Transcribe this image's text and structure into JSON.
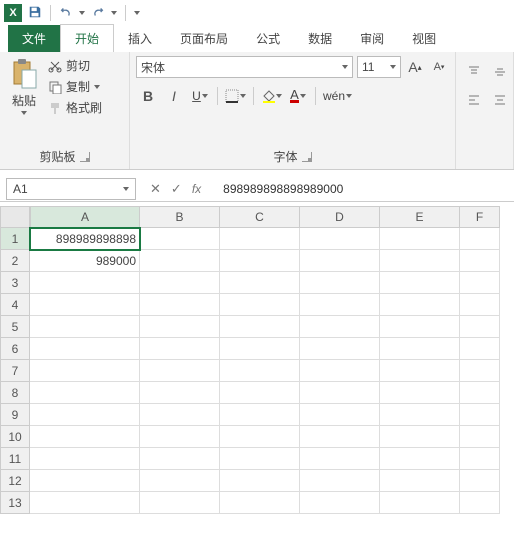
{
  "qat": {
    "app": "X",
    "save": "save",
    "undo": "undo",
    "redo": "redo"
  },
  "tabs": {
    "file": "文件",
    "home": "开始",
    "insert": "插入",
    "layout": "页面布局",
    "formula": "公式",
    "data": "数据",
    "review": "审阅",
    "view": "视图"
  },
  "clipboard": {
    "paste": "粘贴",
    "cut": "剪切",
    "copy": "复制",
    "format": "格式刷",
    "label": "剪贴板"
  },
  "font": {
    "name": "宋体",
    "size": "11",
    "bold": "B",
    "italic": "I",
    "underline": "U",
    "wen": "wén",
    "label": "字体"
  },
  "namebox": "A1",
  "formula_bar": "898989898898989000",
  "columns": [
    "A",
    "B",
    "C",
    "D",
    "E",
    "F"
  ],
  "rows": [
    "1",
    "2",
    "3",
    "4",
    "5",
    "6",
    "7",
    "8",
    "9",
    "10",
    "11",
    "12",
    "13"
  ],
  "cells": {
    "A1": "898989898898",
    "A2": "989000"
  }
}
